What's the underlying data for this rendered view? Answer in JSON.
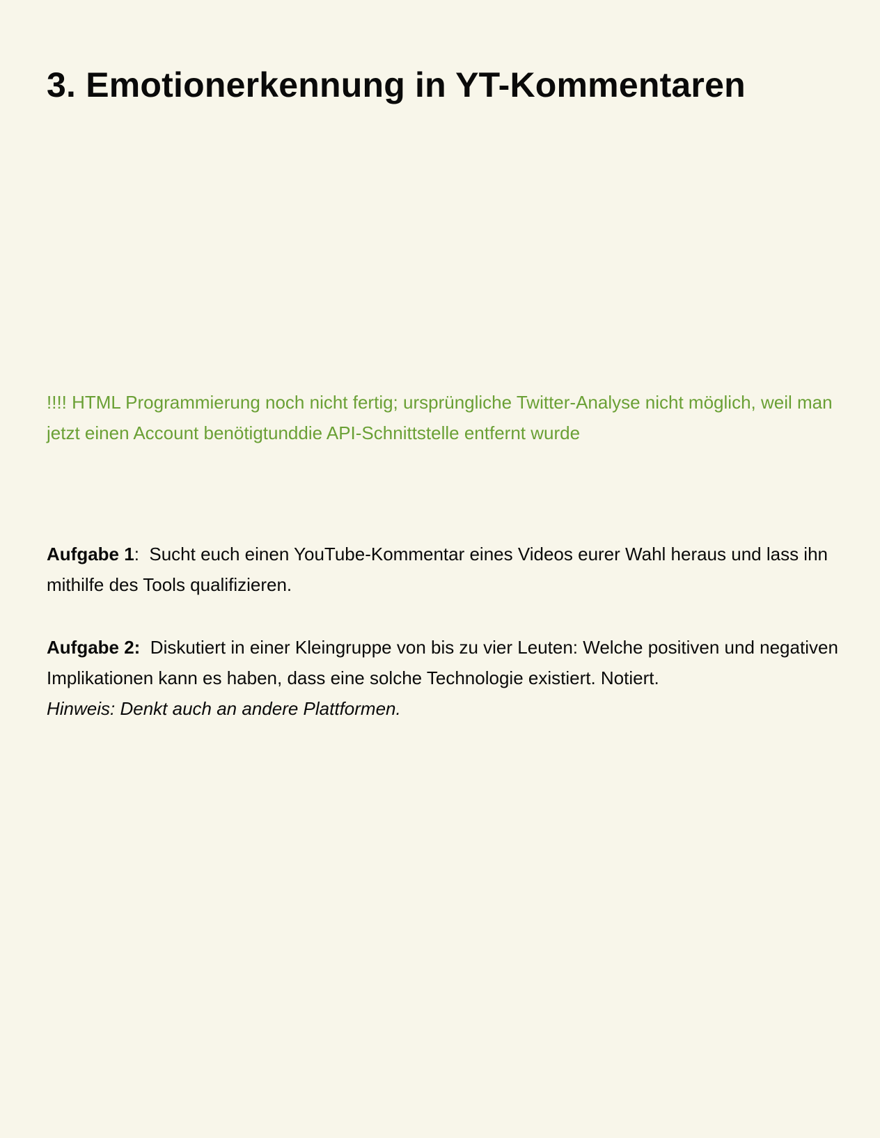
{
  "title": "3. Emotionerkennung in YT-Kommentaren",
  "notice": "!!!! HTML Programmierung noch nicht fertig; ursprüngliche Twitter-Analyse nicht möglich, weil man jetzt einen Account benötigtunddie API-Schnittstelle entfernt wurde",
  "tasks": [
    {
      "label": "Aufgabe 1",
      "separator": ":  ",
      "text": "Sucht euch einen YouTube-Kommentar eines Videos eurer Wahl heraus und lass ihn mithilfe des Tools qualifizieren."
    },
    {
      "label": "Aufgabe 2:",
      "separator": "  ",
      "text": "Diskutiert in einer Kleingruppe von bis zu vier Leuten: Welche positiven und negativen Implikationen kann es haben, dass eine solche Technologie existiert. Notiert.",
      "hint": "Hinweis: Denkt auch an andere Plattformen."
    }
  ],
  "colors": {
    "background": "#f8f6ea",
    "notice": "#6aa035",
    "text": "#0a0a0a"
  }
}
